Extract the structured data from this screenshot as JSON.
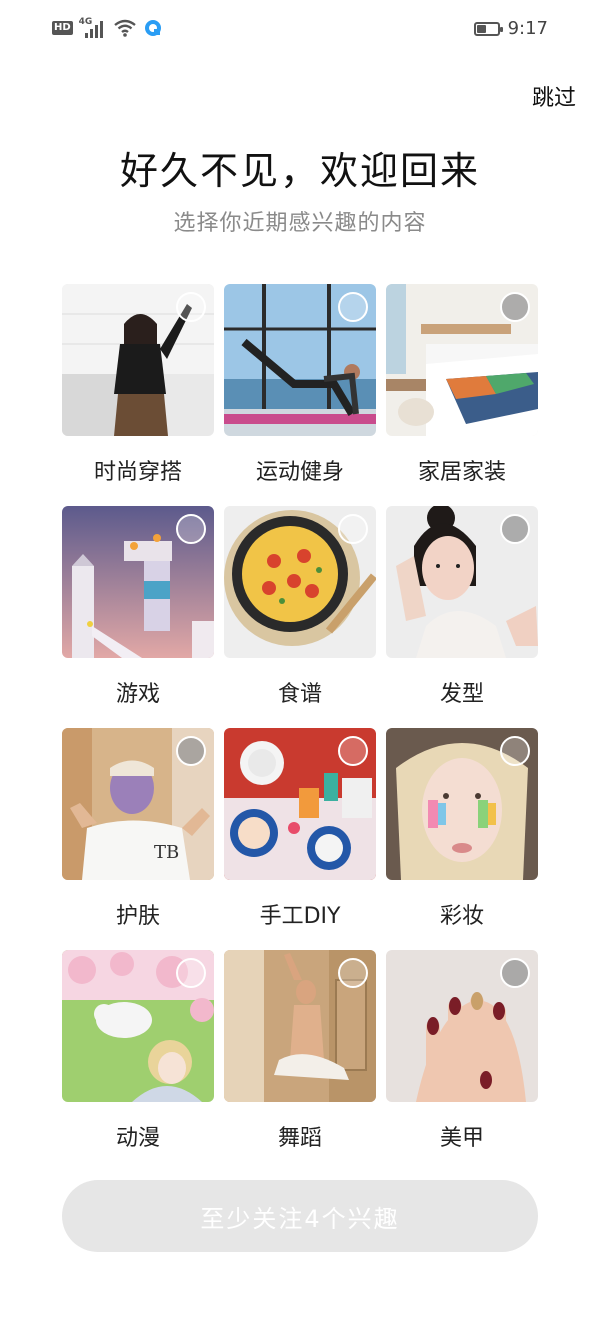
{
  "status_bar": {
    "hd_badge": "HD",
    "network_label": "4G",
    "time": "9:17",
    "icons": [
      "hd-icon",
      "signal-icon",
      "wifi-icon",
      "app-notification-icon",
      "battery-icon"
    ]
  },
  "header": {
    "skip_label": "跳过",
    "title": "好久不见，欢迎回来",
    "subtitle": "选择你近期感兴趣的内容"
  },
  "interests": [
    {
      "label": "时尚穿搭"
    },
    {
      "label": "运动健身"
    },
    {
      "label": "家居家装"
    },
    {
      "label": "游戏"
    },
    {
      "label": "食谱"
    },
    {
      "label": "发型"
    },
    {
      "label": "护肤"
    },
    {
      "label": "手工DIY"
    },
    {
      "label": "彩妆"
    },
    {
      "label": "动漫"
    },
    {
      "label": "舞蹈"
    },
    {
      "label": "美甲"
    }
  ],
  "footer": {
    "button_label": "至少关注4个兴趣",
    "button_color": "#e6e6e6"
  }
}
